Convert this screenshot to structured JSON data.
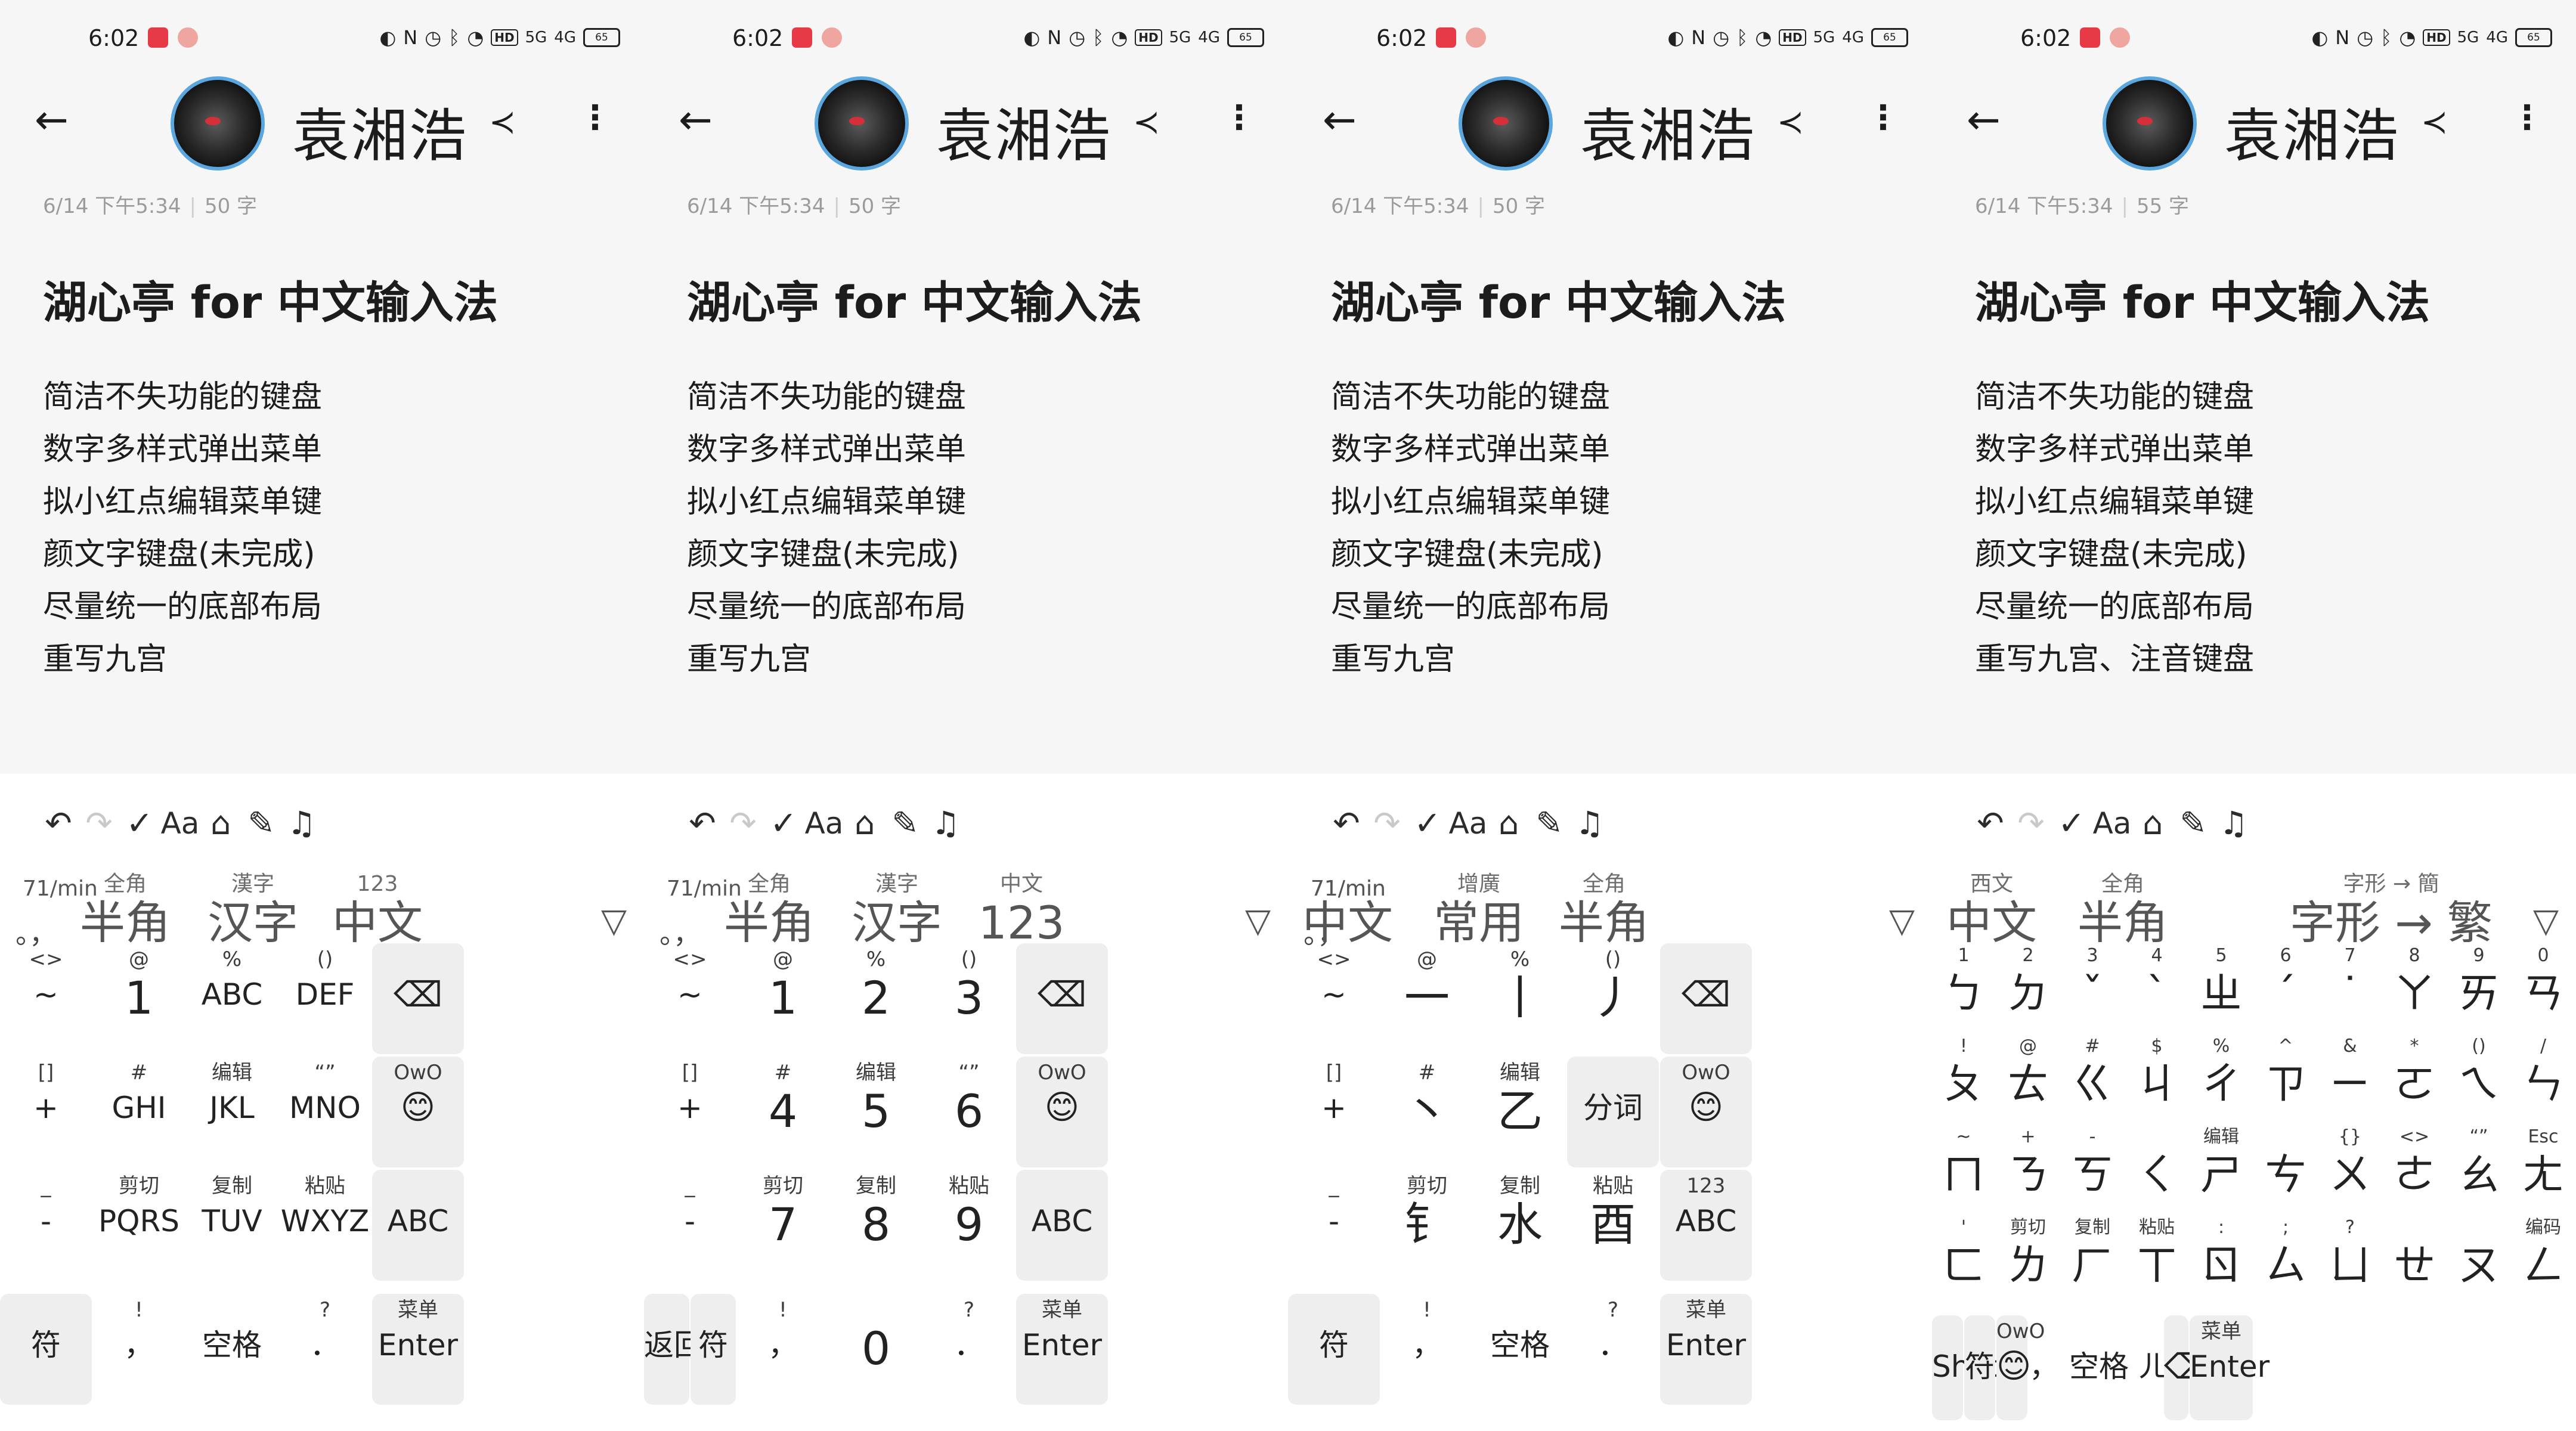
{
  "status": {
    "time": "6:02",
    "battery": "65",
    "hd": "HD",
    "net1": "5G",
    "net2": "4G",
    "icons": [
      "red-app-icon",
      "heart-app-icon",
      "alarm-icon",
      "nfc-icon",
      "clock-icon",
      "bluetooth-icon",
      "wifi-icon"
    ]
  },
  "note": {
    "author": "袁湘浩",
    "date": "6/14 下午5:34",
    "title": "湖心亭 for 中文输入法",
    "lines": [
      "简洁不失功能的键盘",
      "数字多样式弹出菜单",
      "拟小红点编辑菜单键",
      "颜文字键盘(未完成)",
      "尽量统一的底部布局"
    ]
  },
  "toolbar": {
    "undo": "↶",
    "redo": "↷",
    "check": "✓",
    "aa": "Aa",
    "camera": "⌂",
    "pen": "✎",
    "mic": "♫"
  },
  "common": {
    "rate": "71/min",
    "dotcomma": "。，",
    "collapse": "▽",
    "backspace": "⌫"
  },
  "panels": [
    {
      "count": "50 字",
      "last_line": "重写九宫",
      "cands": [
        {
          "s": "全角",
          "b": "半角"
        },
        {
          "s": "漢字",
          "b": "汉字"
        },
        {
          "s": "123",
          "b": "中文"
        }
      ],
      "rows": [
        [
          {
            "s": "<>",
            "m": "~"
          },
          {
            "s": "@",
            "m": "1"
          },
          {
            "s": "%",
            "m": "ABC"
          },
          {
            "s": "()",
            "m": "DEF"
          },
          {
            "s": "",
            "m": "⌫",
            "dark": true
          }
        ],
        [
          {
            "s": "[]",
            "m": "+"
          },
          {
            "s": "#",
            "m": "GHI"
          },
          {
            "s": "编辑",
            "m": "JKL"
          },
          {
            "s": "“”",
            "m": "MNO"
          },
          {
            "s": "OwO",
            "m": "😊",
            "dark": true
          }
        ],
        [
          {
            "s": "_",
            "m": "-"
          },
          {
            "s": "剪切",
            "m": "PQRS"
          },
          {
            "s": "复制",
            "m": "TUV"
          },
          {
            "s": "粘贴",
            "m": "WXYZ"
          },
          {
            "s": "",
            "m": "ABC",
            "dark": true
          }
        ]
      ],
      "bottom": [
        {
          "s": "",
          "m": "符",
          "dark": true,
          "w": 1
        },
        {
          "s": "!",
          "m": "，",
          "w": 1
        },
        {
          "s": "",
          "m": "空格",
          "w": 1
        },
        {
          "s": "?",
          "m": "．",
          "w": 1
        },
        {
          "s": "菜单",
          "m": "Enter",
          "dark": true,
          "w": 1
        }
      ]
    },
    {
      "count": "50 字",
      "last_line": "重写九宫",
      "cands": [
        {
          "s": "全角",
          "b": "半角"
        },
        {
          "s": "漢字",
          "b": "汉字"
        },
        {
          "s": "中文",
          "b": "123"
        }
      ],
      "rows": [
        [
          {
            "s": "<>",
            "m": "~"
          },
          {
            "s": "@",
            "m": "1"
          },
          {
            "s": "%",
            "m": "2"
          },
          {
            "s": "()",
            "m": "3"
          },
          {
            "s": "",
            "m": "⌫",
            "dark": true
          }
        ],
        [
          {
            "s": "[]",
            "m": "+"
          },
          {
            "s": "#",
            "m": "4"
          },
          {
            "s": "编辑",
            "m": "5"
          },
          {
            "s": "“”",
            "m": "6"
          },
          {
            "s": "OwO",
            "m": "😊",
            "dark": true
          }
        ],
        [
          {
            "s": "_",
            "m": "-"
          },
          {
            "s": "剪切",
            "m": "7"
          },
          {
            "s": "复制",
            "m": "8"
          },
          {
            "s": "粘贴",
            "m": "9"
          },
          {
            "s": "",
            "m": "ABC",
            "dark": true
          }
        ]
      ],
      "bottom": [
        {
          "s": "",
          "m": "返回",
          "dark": true,
          "w": 0.5
        },
        {
          "s": "",
          "m": "符",
          "dark": true,
          "w": 0.5
        },
        {
          "s": "!",
          "m": "，",
          "w": 1
        },
        {
          "s": "",
          "m": "0",
          "w": 1
        },
        {
          "s": "?",
          "m": "．",
          "w": 1
        },
        {
          "s": "菜单",
          "m": "Enter",
          "dark": true,
          "w": 1
        }
      ]
    },
    {
      "count": "50 字",
      "last_line": "重写九宫",
      "cands": [
        {
          "s": "",
          "b": "中文"
        },
        {
          "s": "增廣",
          "b": "常用"
        },
        {
          "s": "全角",
          "b": "半角"
        }
      ],
      "rows": [
        [
          {
            "s": "<>",
            "m": "~"
          },
          {
            "s": "@",
            "m": "一"
          },
          {
            "s": "%",
            "m": "丨"
          },
          {
            "s": "()",
            "m": "丿"
          },
          {
            "s": "",
            "m": "⌫",
            "dark": true
          }
        ],
        [
          {
            "s": "[]",
            "m": "+"
          },
          {
            "s": "#",
            "m": "丶"
          },
          {
            "s": "编辑",
            "m": "乙"
          },
          {
            "s": "",
            "m": "分词",
            "dark": true
          },
          {
            "s": "OwO",
            "m": "😊",
            "dark": true
          }
        ],
        [
          {
            "s": "_",
            "m": "-"
          },
          {
            "s": "剪切",
            "m": "钅"
          },
          {
            "s": "复制",
            "m": "水"
          },
          {
            "s": "粘贴",
            "m": "酉"
          },
          {
            "s": "123",
            "m": "ABC",
            "dark": true
          }
        ]
      ],
      "bottom": [
        {
          "s": "",
          "m": "符",
          "dark": true,
          "w": 1
        },
        {
          "s": "!",
          "m": "，",
          "w": 1
        },
        {
          "s": "",
          "m": "空格",
          "w": 1
        },
        {
          "s": "?",
          "m": "．",
          "w": 1
        },
        {
          "s": "菜单",
          "m": "Enter",
          "dark": true,
          "w": 1
        }
      ]
    },
    {
      "count": "55 字",
      "last_line": "重写九宫、注音键盘",
      "cands": [
        {
          "s": "西文",
          "b": "中文"
        },
        {
          "s": "全角",
          "b": "半角"
        },
        {
          "s": "字形 → 簡",
          "b": "字形 → 繁"
        }
      ],
      "zrows": [
        [
          {
            "s": "1",
            "m": "ㄅ"
          },
          {
            "s": "2",
            "m": "ㄉ"
          },
          {
            "s": "3",
            "m": "ˇ"
          },
          {
            "s": "4",
            "m": "ˋ"
          },
          {
            "s": "5",
            "m": "ㄓ"
          },
          {
            "s": "6",
            "m": "ˊ"
          },
          {
            "s": "7",
            "m": "˙"
          },
          {
            "s": "8",
            "m": "ㄚ"
          },
          {
            "s": "9",
            "m": "ㄞ"
          },
          {
            "s": "0",
            "m": "ㄢ"
          }
        ],
        [
          {
            "s": "!",
            "m": "ㄆ"
          },
          {
            "s": "@",
            "m": "ㄊ"
          },
          {
            "s": "#",
            "m": "ㄍ"
          },
          {
            "s": "$",
            "m": "ㄐ"
          },
          {
            "s": "%",
            "m": "ㄔ"
          },
          {
            "s": "^",
            "m": "ㄗ"
          },
          {
            "s": "&",
            "m": "ㄧ"
          },
          {
            "s": "*",
            "m": "ㄛ"
          },
          {
            "s": "()",
            "m": "ㄟ"
          },
          {
            "s": "/",
            "m": "ㄣ"
          }
        ],
        [
          {
            "s": "~",
            "m": "ㄇ"
          },
          {
            "s": "+",
            "m": "ㄋ"
          },
          {
            "s": "-",
            "m": "ㄎ"
          },
          {
            "s": "",
            "m": "ㄑ"
          },
          {
            "s": "编辑",
            "m": "ㄕ"
          },
          {
            "s": "",
            "m": "ㄘ"
          },
          {
            "s": "{}",
            "m": "ㄨ"
          },
          {
            "s": "<>",
            "m": "ㄜ"
          },
          {
            "s": "“”",
            "m": "ㄠ"
          },
          {
            "s": "Esc",
            "m": "ㄤ"
          }
        ],
        [
          {
            "s": "'",
            "m": "ㄈ"
          },
          {
            "s": "剪切",
            "m": "ㄌ"
          },
          {
            "s": "复制",
            "m": "ㄏ"
          },
          {
            "s": "粘贴",
            "m": "ㄒ"
          },
          {
            "s": ":",
            "m": "ㄖ"
          },
          {
            "s": ";",
            "m": "ㄙ"
          },
          {
            "s": "?",
            "m": "ㄩ"
          },
          {
            "s": "",
            "m": "ㄝ"
          },
          {
            "s": "",
            "m": "ㄡ"
          },
          {
            "s": "编码",
            "m": "ㄥ"
          }
        ]
      ],
      "bottom": [
        {
          "s": "",
          "m": "Shift",
          "dark": true,
          "w": 0.5
        },
        {
          "s": "",
          "m": "符",
          "dark": true,
          "w": 0.5
        },
        {
          "s": "OwO",
          "m": "😊",
          "dark": true,
          "w": 0.5
        },
        {
          "s": "",
          "m": "，",
          "w": 0.5
        },
        {
          "s": "",
          "m": "空格",
          "w": 1.2
        },
        {
          "s": "",
          "m": "ㄦ",
          "w": 0.4
        },
        {
          "s": "",
          "m": "⌫",
          "dark": true,
          "w": 0.4
        },
        {
          "s": "菜单",
          "m": "Enter",
          "dark": true,
          "w": 1
        }
      ]
    }
  ]
}
